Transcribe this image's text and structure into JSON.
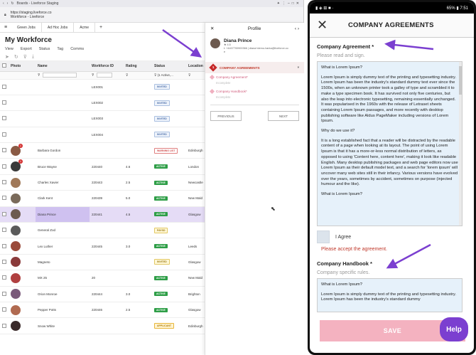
{
  "browser": {
    "window_title": "Boards - Liveforce Staging",
    "url": "https://staging.liveforce.co",
    "url_sub": "Workforce - Liveforce",
    "tabs": [
      "Green Jobs",
      "Ad Hoc Jobs",
      "Acme"
    ],
    "page_title": "My Workforce",
    "menu": [
      "View",
      "Export",
      "Status",
      "Tag",
      "Comms"
    ],
    "columns": [
      "Photo",
      "Name",
      "Workforce ID",
      "Rating",
      "Status",
      "Location"
    ],
    "status_filter": "(1 Active,...",
    "rows": [
      {
        "name": "",
        "id": "LEX001",
        "rating": "",
        "status": "INVITED",
        "status_kind": "invited",
        "location": "",
        "photo": false
      },
      {
        "name": "",
        "id": "LEX002",
        "rating": "",
        "status": "INVITED",
        "status_kind": "invited",
        "location": "",
        "photo": false
      },
      {
        "name": "",
        "id": "LEX003",
        "rating": "",
        "status": "INVITED",
        "status_kind": "invited",
        "location": "",
        "photo": false
      },
      {
        "name": "",
        "id": "LEX004",
        "rating": "",
        "status": "INVITED",
        "status_kind": "invited",
        "location": "",
        "photo": false
      },
      {
        "name": "Barbara Gordon",
        "id": "",
        "rating": "",
        "status": "WARNING LIST",
        "status_kind": "warning",
        "location": "Edinburgh",
        "photo": true,
        "color": "#8a5a44",
        "notif": "1"
      },
      {
        "name": "Bruce Wayne",
        "id": "220440",
        "rating": "4.6",
        "status": "ACTIVE",
        "status_kind": "active",
        "location": "London",
        "photo": true,
        "color": "#3a3a3a",
        "notif": "1"
      },
      {
        "name": "Charles Xavier",
        "id": "220443",
        "rating": "2.5",
        "status": "ACTIVE",
        "status_kind": "active",
        "location": "Newcastle",
        "photo": true,
        "color": "#a07858"
      },
      {
        "name": "Clark Kent",
        "id": "220439",
        "rating": "5.0",
        "status": "ACTIVE",
        "status_kind": "active",
        "location": "New Mald",
        "photo": true,
        "color": "#7a6a5a"
      },
      {
        "name": "Diana Prince",
        "id": "220441",
        "rating": "4.5",
        "status": "ACTIVE",
        "status_kind": "active",
        "location": "Glasgow",
        "photo": true,
        "color": "#6d5a4f",
        "selected": true
      },
      {
        "name": "General Zod",
        "id": "",
        "rating": "",
        "status": "PAYSD",
        "status_kind": "paysd",
        "location": "",
        "photo": true,
        "color": "#5a5a5a"
      },
      {
        "name": "Lex Luther",
        "id": "220445",
        "rating": "3.0",
        "status": "ACTIVE",
        "status_kind": "active",
        "location": "Leeds",
        "photo": true,
        "color": "#9a4a3a"
      },
      {
        "name": "Magneto",
        "id": "",
        "rating": "",
        "status": "INVITED",
        "status_kind": "paysd",
        "location": "Glasgow",
        "photo": true,
        "color": "#8a3a3a"
      },
      {
        "name": "MX 25",
        "id": "20",
        "rating": "",
        "status": "ACTIVE",
        "status_kind": "active",
        "location": "New Mald",
        "photo": true,
        "color": "#b04040"
      },
      {
        "name": "Orion Monroe",
        "id": "220444",
        "rating": "3.0",
        "status": "ACTIVE",
        "status_kind": "active",
        "location": "Brighton",
        "photo": true,
        "color": "#7a5a7a"
      },
      {
        "name": "Pepper Potts",
        "id": "220446",
        "rating": "2.5",
        "status": "ACTIVE",
        "status_kind": "active",
        "location": "Glasgow",
        "photo": true,
        "color": "#b06a50"
      },
      {
        "name": "Snow White",
        "id": "",
        "rating": "",
        "status": "APPLICANT",
        "status_kind": "applicant",
        "location": "Edinburgh",
        "photo": true,
        "color": "#3a2a2a"
      }
    ]
  },
  "profile": {
    "title": "Profile",
    "name": "Diana Prince",
    "rating": "4.5",
    "contact": "t: +4407700900366 | diana+demo-harka@liveforce.co",
    "contact2": "e",
    "section_number": "1",
    "section_title": "COMPANY AGREEMENTS",
    "items": [
      {
        "label": "Company Agreement*",
        "sub": "Incomplete"
      },
      {
        "label": "Company Handbook*",
        "sub": "Incomplete"
      }
    ],
    "previous_label": "PREVIOUS",
    "next_label": "NEXT"
  },
  "phone": {
    "status_left": "▮ ◈ ⊞ ■ ·",
    "status_right": "65% ▮ 7:51",
    "title": "COMPANY AGREEMENTS",
    "agreement_label": "Company Agreement *",
    "agreement_sub": "Please read and sign.",
    "agreement_p1": "What is Lorem Ipsum?",
    "agreement_p2": "Lorem Ipsum is simply dummy text of the printing and typesetting industry. Lorem Ipsum has been the industry's standard dummy text ever since the 1500s, when an unknown printer took a galley of type and scrambled it to make a type specimen book. It has survived not only five centuries, but also the leap into electronic typesetting, remaining essentially unchanged. It was popularised in the 1960s with the release of Letraset sheets containing Lorem Ipsum passages, and more recently with desktop publishing software like Aldus PageMaker including versions of Lorem Ipsum.",
    "agreement_p3": "Why do we use it?",
    "agreement_p4": "It is a long established fact that a reader will be distracted by the readable content of a page when looking at its layout. The point of using Lorem Ipsum is that it has a more-or-less normal distribution of letters, as opposed to using 'Content here, content here', making it look like readable English. Many desktop publishing packages and web page editors now use Lorem Ipsum as their default model text, and a search for 'lorem ipsum' will uncover many web sites still in their infancy. Various versions have evolved over the years, sometimes by accident, sometimes on purpose (injected humour and the like).",
    "agreement_p5": "What is Lorem Ipsum?",
    "agree_label": "I Agree",
    "error": "Please accept the agreement.",
    "handbook_label": "Company Handbook *",
    "handbook_sub": "Company specific rules.",
    "handbook_p1": "What is Lorem Ipsum?",
    "handbook_p2": "Lorem Ipsum is simply dummy text of the printing and typesetting industry. Lorem Ipsum has been the industry's standard dummy",
    "save_label": "SAVE",
    "help_label": "Help"
  },
  "colors": {
    "accent": "#7b3fd0",
    "arrow": "#7b3fd0",
    "error": "#c0392b",
    "save": "#f4b2c0"
  }
}
